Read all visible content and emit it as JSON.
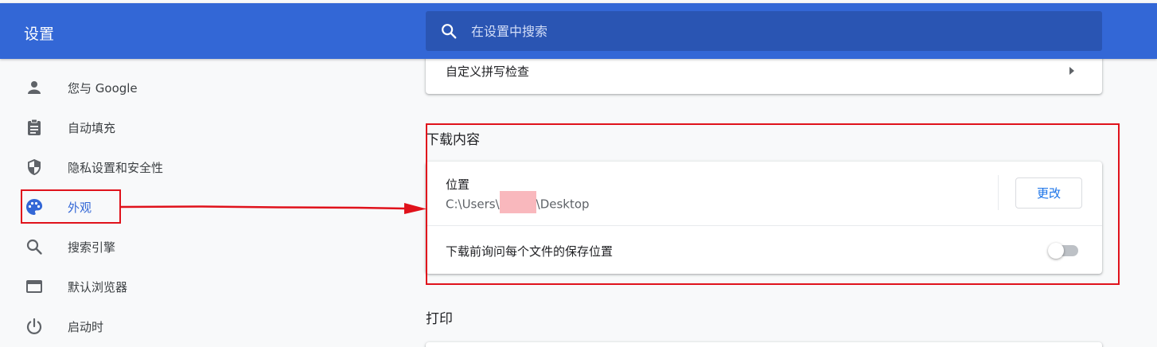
{
  "app": {
    "title": "设置"
  },
  "search": {
    "placeholder": "在设置中搜索"
  },
  "sidebar": {
    "items": [
      {
        "label": "您与 Google",
        "icon": "person-icon"
      },
      {
        "label": "自动填充",
        "icon": "clipboard-icon"
      },
      {
        "label": "隐私设置和安全性",
        "icon": "shield-icon"
      },
      {
        "label": "外观",
        "icon": "palette-icon",
        "active": true
      },
      {
        "label": "搜索引擎",
        "icon": "search-icon"
      },
      {
        "label": "默认浏览器",
        "icon": "browser-icon"
      },
      {
        "label": "启动时",
        "icon": "power-icon"
      }
    ]
  },
  "main": {
    "spellcheck_label": "自定义拼写检查",
    "downloads": {
      "title": "下载内容",
      "location_label": "位置",
      "location_path_prefix": "C:\\Users\\",
      "location_path_suffix": "\\Desktop",
      "change_button": "更改",
      "ask_label": "下载前询问每个文件的保存位置",
      "ask_enabled": false
    },
    "print_title": "打印"
  },
  "colors": {
    "header": "#3367d6",
    "search_bg": "#2a55b3",
    "accent": "#1a73e8",
    "annotation": "#e0121b"
  }
}
